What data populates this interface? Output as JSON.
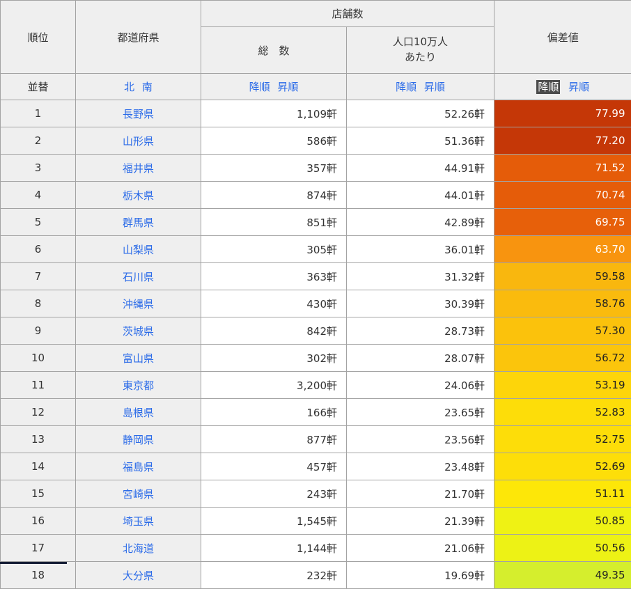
{
  "table": {
    "headers": {
      "rank": "順位",
      "prefecture": "都道府県",
      "stores": "店舗数",
      "total": "総　数",
      "per_capita_line1": "人口10万人",
      "per_capita_line2": "あたり",
      "deviation": "偏差値"
    },
    "sort": {
      "label": "並替",
      "north": "北",
      "south": "南",
      "desc": "降順",
      "asc": "昇順"
    },
    "unit_note": "軒",
    "accent_colors": {
      "link_blue": "#2b6be8",
      "selected_sort_bg": "#4b4b4b",
      "header_gray": "#efefef",
      "border_gray": "#a3a3a3"
    },
    "rows": [
      {
        "rank": "1",
        "pref": "長野県",
        "total": "1,109軒",
        "per": "52.26軒",
        "dev": "77.99",
        "bg": "#c53707",
        "fg": "#ffffff"
      },
      {
        "rank": "2",
        "pref": "山形県",
        "total": "586軒",
        "per": "51.36軒",
        "dev": "77.20",
        "bg": "#c53707",
        "fg": "#ffffff"
      },
      {
        "rank": "3",
        "pref": "福井県",
        "total": "357軒",
        "per": "44.91軒",
        "dev": "71.52",
        "bg": "#e55c09",
        "fg": "#ffffff"
      },
      {
        "rank": "4",
        "pref": "栃木県",
        "total": "874軒",
        "per": "44.01軒",
        "dev": "70.74",
        "bg": "#e55c09",
        "fg": "#ffffff"
      },
      {
        "rank": "5",
        "pref": "群馬県",
        "total": "851軒",
        "per": "42.89軒",
        "dev": "69.75",
        "bg": "#e7600a",
        "fg": "#ffffff"
      },
      {
        "rank": "6",
        "pref": "山梨県",
        "total": "305軒",
        "per": "36.01軒",
        "dev": "63.70",
        "bg": "#f8940f",
        "fg": "#ffffff"
      },
      {
        "rank": "7",
        "pref": "石川県",
        "total": "363軒",
        "per": "31.32軒",
        "dev": "59.58",
        "bg": "#f9b70e",
        "fg": "#222222"
      },
      {
        "rank": "8",
        "pref": "沖縄県",
        "total": "430軒",
        "per": "30.39軒",
        "dev": "58.76",
        "bg": "#fabb0d",
        "fg": "#222222"
      },
      {
        "rank": "9",
        "pref": "茨城県",
        "total": "842軒",
        "per": "28.73軒",
        "dev": "57.30",
        "bg": "#fbc20c",
        "fg": "#222222"
      },
      {
        "rank": "10",
        "pref": "富山県",
        "total": "302軒",
        "per": "28.07軒",
        "dev": "56.72",
        "bg": "#fbc50c",
        "fg": "#222222"
      },
      {
        "rank": "11",
        "pref": "東京都",
        "total": "3,200軒",
        "per": "24.06軒",
        "dev": "53.19",
        "bg": "#fdd50a",
        "fg": "#222222"
      },
      {
        "rank": "12",
        "pref": "島根県",
        "total": "166軒",
        "per": "23.65軒",
        "dev": "52.83",
        "bg": "#fddd09",
        "fg": "#222222"
      },
      {
        "rank": "13",
        "pref": "静岡県",
        "total": "877軒",
        "per": "23.56軒",
        "dev": "52.75",
        "bg": "#fddd09",
        "fg": "#222222"
      },
      {
        "rank": "14",
        "pref": "福島県",
        "total": "457軒",
        "per": "23.48軒",
        "dev": "52.69",
        "bg": "#fdde09",
        "fg": "#222222"
      },
      {
        "rank": "15",
        "pref": "宮崎県",
        "total": "243軒",
        "per": "21.70軒",
        "dev": "51.11",
        "bg": "#fde708",
        "fg": "#222222"
      },
      {
        "rank": "16",
        "pref": "埼玉県",
        "total": "1,545軒",
        "per": "21.39軒",
        "dev": "50.85",
        "bg": "#eff214",
        "fg": "#222222"
      },
      {
        "rank": "17",
        "pref": "北海道",
        "total": "1,144軒",
        "per": "21.06軒",
        "dev": "50.56",
        "bg": "#edf215",
        "fg": "#222222"
      },
      {
        "rank": "18",
        "pref": "大分県",
        "total": "232軒",
        "per": "19.69軒",
        "dev": "49.35",
        "bg": "#d5ee2d",
        "fg": "#222222"
      }
    ]
  }
}
